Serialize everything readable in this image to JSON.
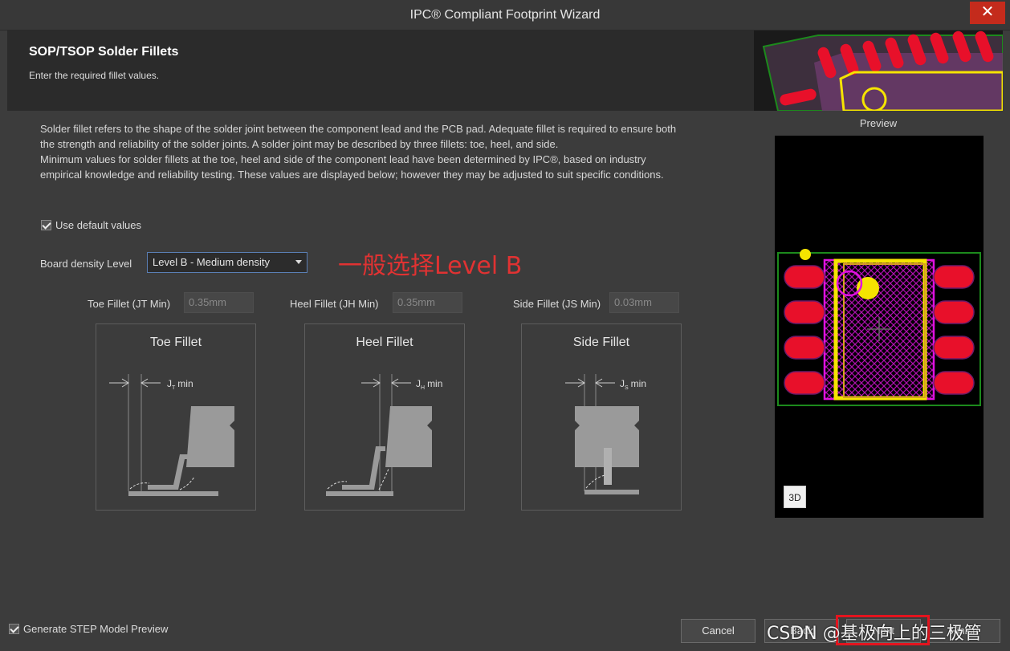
{
  "window": {
    "title": "IPC® Compliant Footprint Wizard",
    "close_glyph": "✕"
  },
  "header": {
    "title": "SOP/TSOP Solder Fillets",
    "subtitle": "Enter the required fillet values."
  },
  "description": [
    "Solder fillet refers to the shape of the solder joint between the component lead and the PCB pad. Adequate fillet is required to ensure both",
    "the strength and reliability of the solder joints. A solder joint may be described by three fillets: toe, heel, and side.",
    "Minimum values for solder fillets at the toe, heel and side of the component lead have been determined by IPC®, based on industry",
    "empirical knowledge and reliability testing. These values are displayed below; however they may be adjusted to suit specific conditions."
  ],
  "use_default": {
    "label": "Use default values",
    "checked": true
  },
  "density": {
    "label": "Board density Level",
    "selected": "Level B - Medium density"
  },
  "annotation": "一般选择Level B",
  "fillets": {
    "toe": {
      "label": "Toe Fillet (JT Min)",
      "value": "0.35mm",
      "diagram_title": "Toe Fillet",
      "j": "J",
      "sub": "T",
      "min": "min"
    },
    "heel": {
      "label": "Heel Fillet (JH Min)",
      "value": "0.35mm",
      "diagram_title": "Heel Fillet",
      "j": "J",
      "sub": "H",
      "min": "min"
    },
    "side": {
      "label": "Side Fillet (JS Min)",
      "value": "0.03mm",
      "diagram_title": "Side Fillet",
      "j": "J",
      "sub": "S",
      "min": "min"
    }
  },
  "preview": {
    "label": "Preview",
    "btn_3d": "3D"
  },
  "footer": {
    "step_label": "Generate STEP Model Preview",
    "step_checked": true,
    "cancel": "Cancel",
    "back": "Back",
    "next": "Next",
    "finish": "Finish"
  },
  "watermark": "CSDN @基极向上的三极管",
  "colors": {
    "pad_red": "#e8102a",
    "silk_yellow": "#f5e400",
    "courtyard_magenta": "#e010e0",
    "board_green": "#1c8a1c",
    "annotation_red": "#e03232"
  }
}
